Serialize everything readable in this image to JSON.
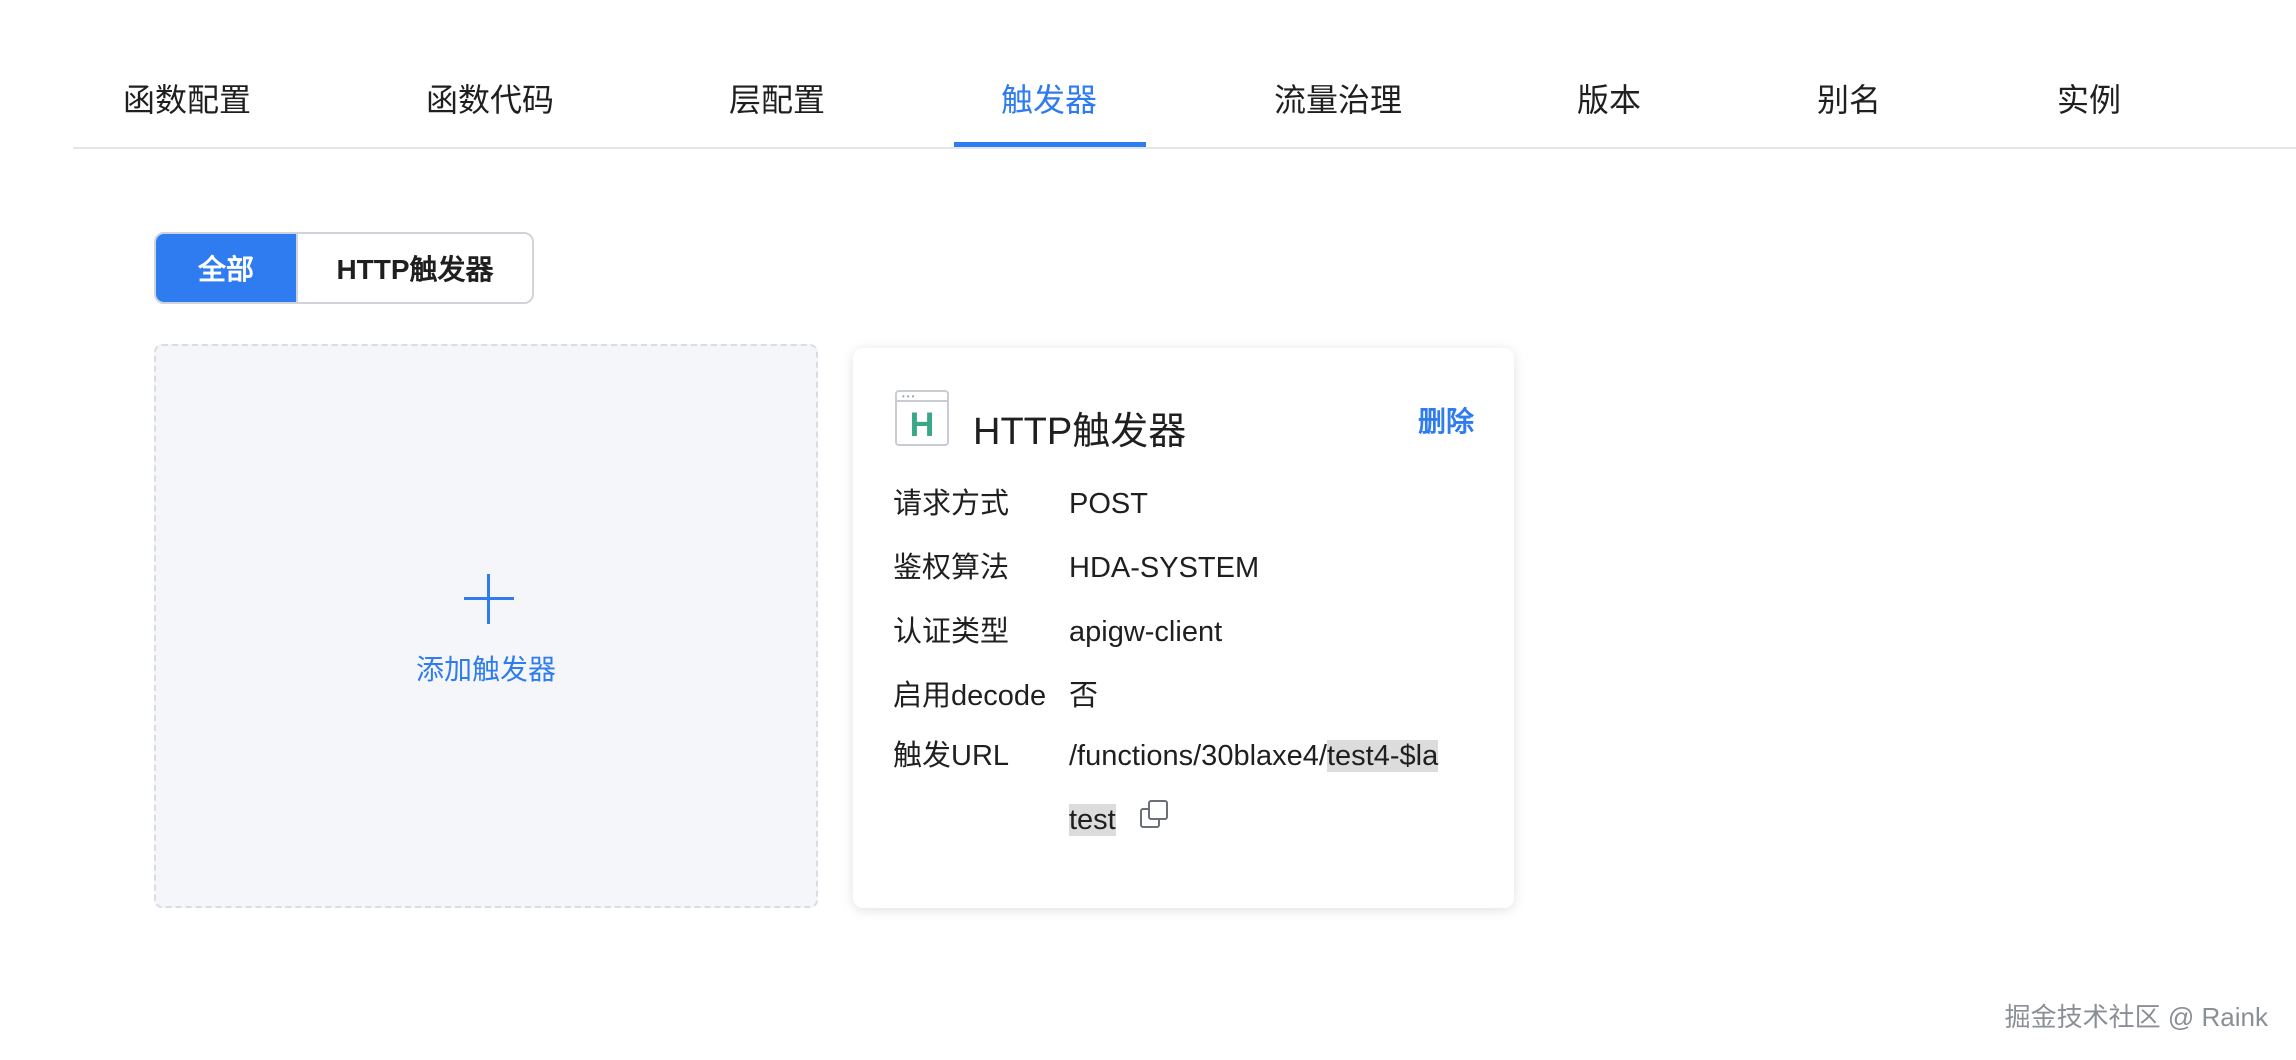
{
  "tabs": [
    {
      "label": "函数配置"
    },
    {
      "label": "函数代码"
    },
    {
      "label": "层配置"
    },
    {
      "label": "触发器"
    },
    {
      "label": "流量治理"
    },
    {
      "label": "版本"
    },
    {
      "label": "别名"
    },
    {
      "label": "实例"
    }
  ],
  "active_tab": "触发器",
  "filter": {
    "all_label": "全部",
    "http_label": "HTTP触发器",
    "active": "全部"
  },
  "add_card": {
    "label": "添加触发器"
  },
  "trigger": {
    "title": "HTTP触发器",
    "icon_letter": "H",
    "delete_label": "删除",
    "fields": [
      {
        "key": "请求方式",
        "value": "POST"
      },
      {
        "key": "鉴权算法",
        "value": "HDA-SYSTEM"
      },
      {
        "key": "认证类型",
        "value": "apigw-client"
      },
      {
        "key": "启用decode",
        "value": "否"
      },
      {
        "key": "触发URL",
        "value": "/functions/30blaxe4/test4-$latest"
      }
    ],
    "url_parts": {
      "line1_plain": "/functions/30blaxe4/",
      "line1_highlight": "test4-$la",
      "line2_highlight": "test"
    }
  },
  "watermark": "掘金技术社区 @ Raink",
  "colors": {
    "accent": "#2f7cf0",
    "icon_green": "#3aa789",
    "highlight": "#dcdcdc"
  }
}
